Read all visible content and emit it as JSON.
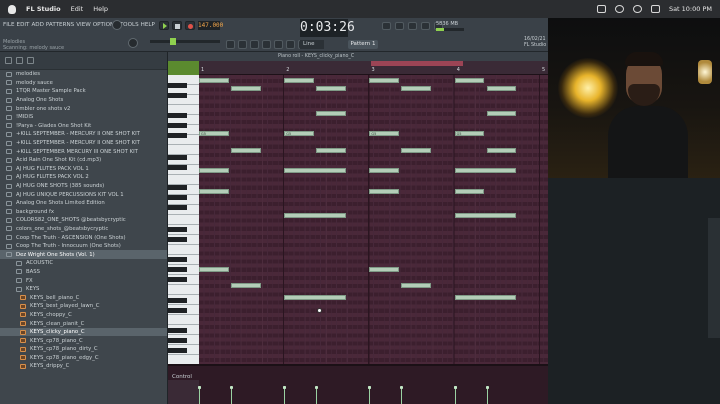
{
  "mac_menubar": {
    "app_name": "FL Studio",
    "menus": [
      "Edit",
      "Help"
    ],
    "datetime": "Sat 10:00 PM"
  },
  "fl_toolbar": {
    "menus": [
      "FILE",
      "EDIT",
      "ADD",
      "PATTERNS",
      "VIEW",
      "OPTIONS",
      "TOOLS",
      "HELP"
    ],
    "hint_line1": "Melodies",
    "hint_line2": "Scanning: melody sauce",
    "tempo": "147.000",
    "time_display": "0:03:26",
    "snap": "Line",
    "pattern": "Pattern 1",
    "cpu_label": "5836 MB",
    "right_info_line1": "16/02/21",
    "right_info_line2": "FL Studio"
  },
  "browser": {
    "items": [
      {
        "label": "melodies",
        "type": "folder",
        "selected": false
      },
      {
        "label": "melody sauce",
        "type": "folder",
        "selected": false
      },
      {
        "label": "1TQR Master Sample Pack",
        "type": "folder",
        "selected": false
      },
      {
        "label": "Analog One Shots",
        "type": "folder",
        "selected": false
      },
      {
        "label": "bmbler one shots v2",
        "type": "folder",
        "selected": false
      },
      {
        "label": "!MIDIS",
        "type": "folder",
        "selected": false
      },
      {
        "label": "!Parya - Glades One Shot Kit",
        "type": "folder",
        "selected": false
      },
      {
        "label": "+KILL SEPTEMBER - MERCURY II ONE SHOT KIT",
        "type": "folder",
        "selected": false
      },
      {
        "label": "+KILL SEPTEMBER - MERCURY II ONE SHOT KIT",
        "type": "folder",
        "selected": false
      },
      {
        "label": "+KILL SEPTEMBER MERCURY III ONE SHOT KIT",
        "type": "folder",
        "selected": false
      },
      {
        "label": "Acid Rain One Shot Kit (cd.mp3)",
        "type": "folder",
        "selected": false
      },
      {
        "label": "AJ HUG FLUTES PACK VOL 1",
        "type": "folder",
        "selected": false
      },
      {
        "label": "AJ HUG FLUTES PACK VOL 2",
        "type": "folder",
        "selected": false
      },
      {
        "label": "AJ HUG ONE SHOTS (385 sounds)",
        "type": "folder",
        "selected": false
      },
      {
        "label": "AJ HUG UNIQUE PERCUSSIONS KIT VOL 1",
        "type": "folder",
        "selected": false
      },
      {
        "label": "Analog One Shots Limited Edition",
        "type": "folder",
        "selected": false
      },
      {
        "label": "background fx",
        "type": "folder",
        "selected": false
      },
      {
        "label": "COLORS82_ONE_SHOTS @beatsbycryptic",
        "type": "folder",
        "selected": false
      },
      {
        "label": "colors_one_shots_@beatsbycryptic",
        "type": "folder",
        "selected": false
      },
      {
        "label": "Coop The Truth - ASCENSION (One Shots)",
        "type": "folder",
        "selected": false
      },
      {
        "label": "Coop The Truth - Innocuum (One Shots)",
        "type": "folder",
        "selected": false
      },
      {
        "label": "Dez Wright One Shots (Vol. 1)",
        "type": "folder",
        "selected": true
      },
      {
        "label": "ACOUSTIC",
        "type": "subfolder",
        "selected": false
      },
      {
        "label": "BASS",
        "type": "subfolder",
        "selected": false
      },
      {
        "label": "FX",
        "type": "subfolder",
        "selected": false
      },
      {
        "label": "KEYS",
        "type": "subfolder",
        "selected": false
      },
      {
        "label": "KEYS_bell_piano_C",
        "type": "file",
        "selected": false
      },
      {
        "label": "KEYS_best_played_lawn_C",
        "type": "file",
        "selected": false
      },
      {
        "label": "KEYS_choppy_C",
        "type": "file",
        "selected": false
      },
      {
        "label": "KEYS_clean_pianit_C",
        "type": "file",
        "selected": false
      },
      {
        "label": "KEYS_clicky_piano_C",
        "type": "file",
        "selected": true
      },
      {
        "label": "KEYS_cp78_piano_C",
        "type": "file",
        "selected": false
      },
      {
        "label": "KEYS_cp78_piano_dirty_C",
        "type": "file",
        "selected": false
      },
      {
        "label": "KEYS_cp78_piano_edgy_C",
        "type": "file",
        "selected": false
      },
      {
        "label": "KEYS_drippy_C",
        "type": "file",
        "selected": false
      }
    ]
  },
  "piano_roll": {
    "title": "Piano roll - KEYS_clicky_piano_C",
    "bars": [
      "1",
      "2",
      "3",
      "4",
      "5"
    ],
    "control_label": "Control",
    "notes": [
      {
        "label": "",
        "start": 0.0,
        "length": 1.4,
        "row": 0
      },
      {
        "label": "",
        "start": 1.5,
        "length": 1.4,
        "row": 2
      },
      {
        "label": "",
        "start": 4.0,
        "length": 1.4,
        "row": 0
      },
      {
        "label": "",
        "start": 5.5,
        "length": 1.4,
        "row": 2
      },
      {
        "label": "",
        "start": 8.0,
        "length": 1.4,
        "row": 0
      },
      {
        "label": "",
        "start": 9.5,
        "length": 1.4,
        "row": 2
      },
      {
        "label": "",
        "start": 12.0,
        "length": 1.4,
        "row": 0
      },
      {
        "label": "",
        "start": 13.5,
        "length": 1.4,
        "row": 2
      },
      {
        "label": "",
        "start": 5.5,
        "length": 1.4,
        "row": 8
      },
      {
        "label": "",
        "start": 13.5,
        "length": 1.4,
        "row": 8
      },
      {
        "label": "G5",
        "start": 0.0,
        "length": 1.4,
        "row": 13
      },
      {
        "label": "G5",
        "start": 4.0,
        "length": 1.4,
        "row": 13
      },
      {
        "label": "G5",
        "start": 8.0,
        "length": 1.4,
        "row": 13
      },
      {
        "label": "G5",
        "start": 12.0,
        "length": 1.4,
        "row": 13
      },
      {
        "label": "",
        "start": 1.5,
        "length": 1.4,
        "row": 17
      },
      {
        "label": "",
        "start": 5.5,
        "length": 1.4,
        "row": 17
      },
      {
        "label": "",
        "start": 9.5,
        "length": 1.4,
        "row": 17
      },
      {
        "label": "",
        "start": 13.5,
        "length": 1.4,
        "row": 17
      },
      {
        "label": "",
        "start": 0.0,
        "length": 1.4,
        "row": 22
      },
      {
        "label": "",
        "start": 4.0,
        "length": 2.9,
        "row": 22
      },
      {
        "label": "",
        "start": 8.0,
        "length": 1.4,
        "row": 22
      },
      {
        "label": "",
        "start": 12.0,
        "length": 2.9,
        "row": 22
      },
      {
        "label": "",
        "start": 0.0,
        "length": 1.4,
        "row": 27
      },
      {
        "label": "",
        "start": 8.0,
        "length": 1.4,
        "row": 27
      },
      {
        "label": "",
        "start": 12.0,
        "length": 1.4,
        "row": 27
      },
      {
        "label": "",
        "start": 4.0,
        "length": 2.9,
        "row": 33
      },
      {
        "label": "",
        "start": 12.0,
        "length": 2.9,
        "row": 33
      },
      {
        "label": "",
        "start": 0.0,
        "length": 1.4,
        "row": 46
      },
      {
        "label": "",
        "start": 8.0,
        "length": 1.4,
        "row": 46
      },
      {
        "label": "",
        "start": 1.5,
        "length": 1.4,
        "row": 50
      },
      {
        "label": "",
        "start": 9.5,
        "length": 1.4,
        "row": 50
      },
      {
        "label": "",
        "start": 4.0,
        "length": 2.9,
        "row": 53
      },
      {
        "label": "",
        "start": 12.0,
        "length": 2.9,
        "row": 53
      }
    ]
  },
  "colors": {
    "note_fill": "#b4cdb8",
    "roll_bg": "#3f2232",
    "loop_marker": "#9c4455",
    "accent_green": "#8fd14f"
  }
}
